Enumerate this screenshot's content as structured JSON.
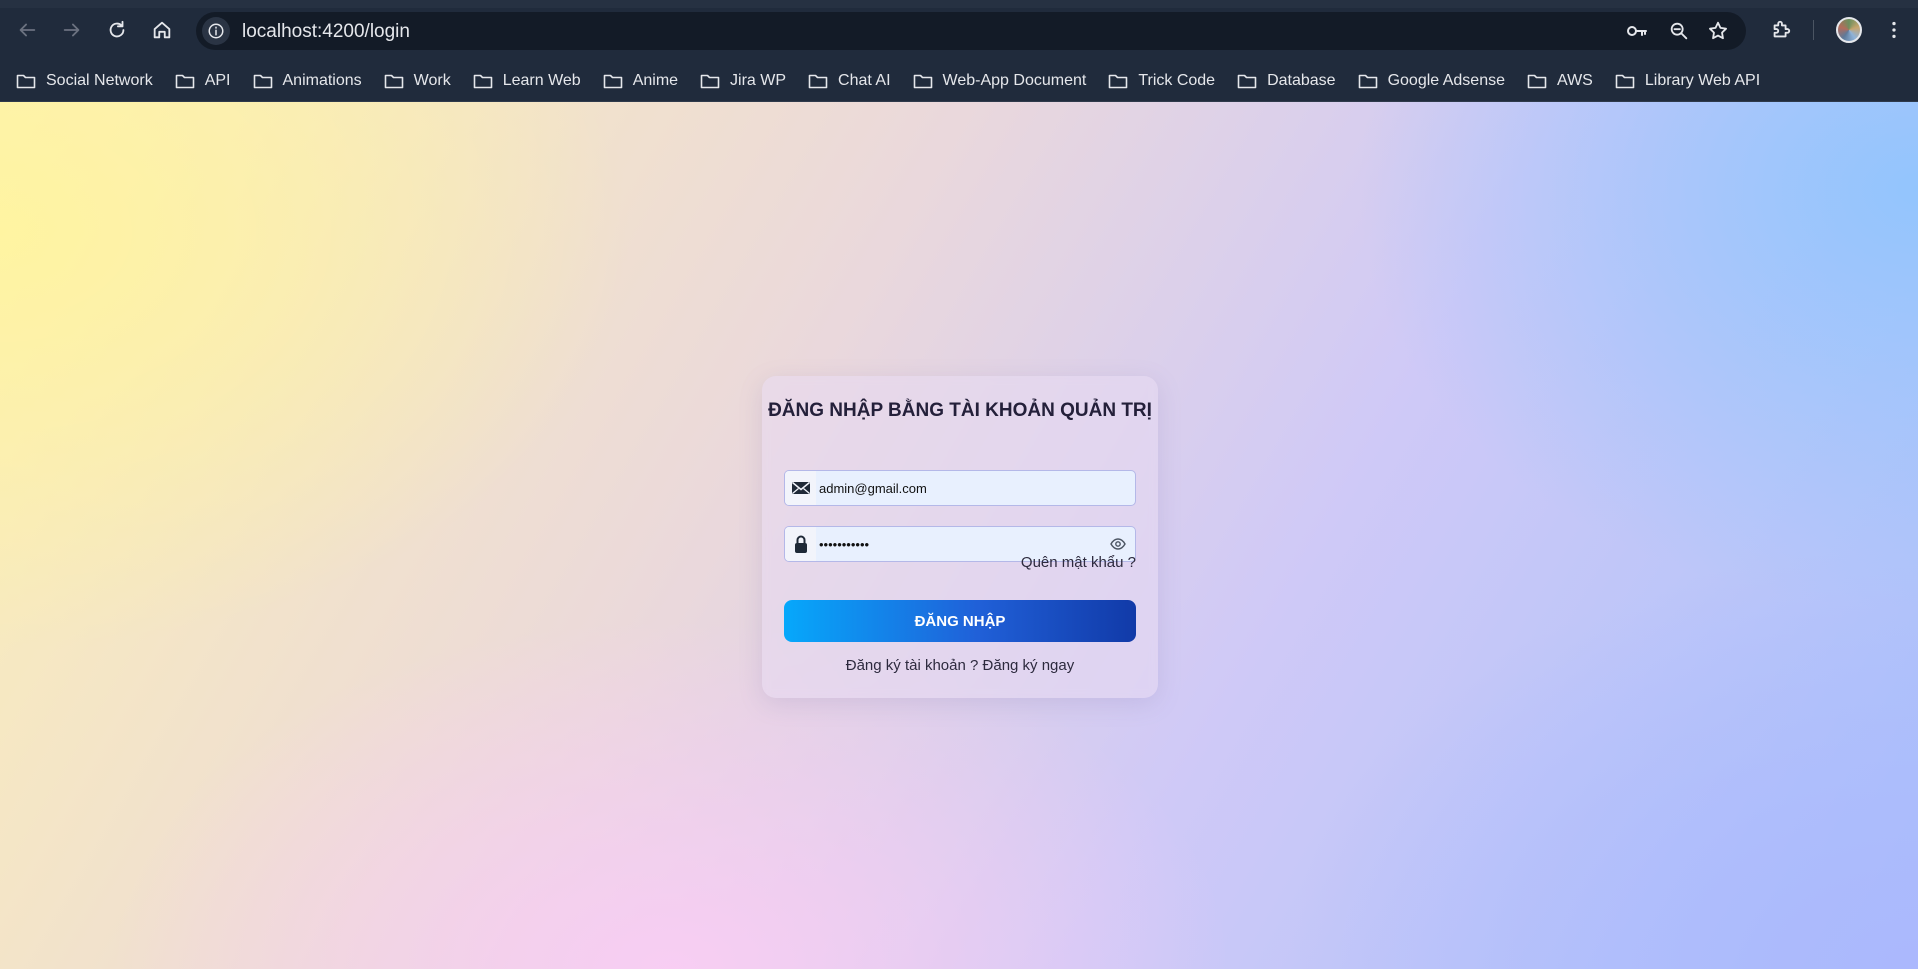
{
  "browser": {
    "url": "localhost:4200/login",
    "bookmarks": [
      {
        "label": "Social Network"
      },
      {
        "label": "API"
      },
      {
        "label": "Animations"
      },
      {
        "label": "Work"
      },
      {
        "label": "Learn Web"
      },
      {
        "label": "Anime"
      },
      {
        "label": "Jira WP"
      },
      {
        "label": "Chat AI"
      },
      {
        "label": "Web-App Document"
      },
      {
        "label": "Trick Code"
      },
      {
        "label": "Database"
      },
      {
        "label": "Google Adsense"
      },
      {
        "label": "AWS"
      },
      {
        "label": "Library Web API"
      }
    ]
  },
  "login": {
    "title": "ĐĂNG NHẬP BẰNG TÀI KHOẢN QUẢN TRỊ",
    "email_value": "admin@gmail.com",
    "password_value": "•••••••••••",
    "forgot_label": "Quên mật khẩu ?",
    "submit_label": "ĐĂNG NHẬP",
    "register_prompt": "Đăng ký tài khoản ?",
    "register_link": "Đăng ký ngay"
  },
  "colors": {
    "button_gradient_start": "#06a8fb",
    "button_gradient_end": "#113aa8",
    "title_color": "#24203a"
  }
}
